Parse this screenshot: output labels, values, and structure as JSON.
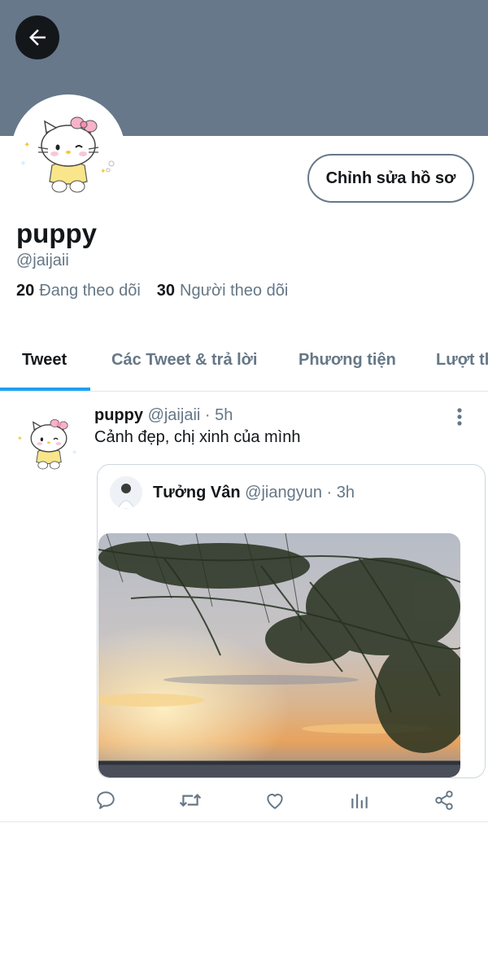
{
  "profile": {
    "name": "puppy",
    "handle": "@jaijaii",
    "edit_button_label": "Chỉnh sửa hồ sơ",
    "following_count": "20",
    "following_label": "Đang theo dõi",
    "followers_count": "30",
    "followers_label": "Người theo dõi"
  },
  "tabs": [
    {
      "label": "Tweet",
      "active": true
    },
    {
      "label": "Các Tweet & trả lời",
      "active": false
    },
    {
      "label": "Phương tiện",
      "active": false
    },
    {
      "label": "Lượt thích",
      "active": false
    }
  ],
  "tweet": {
    "author_name": "puppy",
    "author_handle": "@jaijaii",
    "separator": "·",
    "time": "5h",
    "text": "Cảnh đẹp, chị xinh của mình",
    "quote": {
      "author_name": "Tưởng Vân",
      "author_handle": "@jiangyun",
      "separator": "·",
      "time": "3h"
    },
    "actions": [
      "reply-icon",
      "retweet-icon",
      "like-icon",
      "analytics-icon",
      "share-icon"
    ]
  },
  "colors": {
    "banner": "#66788a",
    "accent": "#1da1f2",
    "text_primary": "#14171a",
    "text_secondary": "#657786"
  }
}
